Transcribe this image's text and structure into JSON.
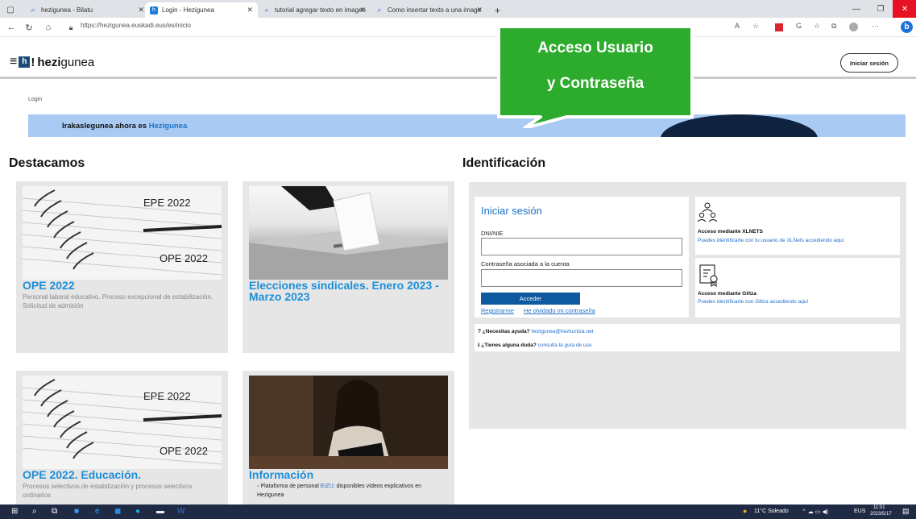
{
  "browser": {
    "tabs": [
      {
        "label": "hezigunea - Bilatu",
        "icon": "search-icon",
        "color": "#2b6fd6"
      },
      {
        "label": "Login - Hezigunea",
        "icon": "hezigunea-icon",
        "color": "#1c7ed6"
      },
      {
        "label": "tutorial agregar texto en imagen",
        "icon": "search-icon",
        "color": "#2b6fd6"
      },
      {
        "label": "Como insertar texto a una image",
        "icon": "search-icon",
        "color": "#2b6fd6"
      }
    ],
    "new_tab": "+",
    "url": "https://hezigunea.euskadi.eus/es/inicio"
  },
  "site": {
    "logo_prefix": "hezi",
    "logo_suffix": "gunea",
    "login_button": "Iniciar sesión",
    "breadcrumb": "Login",
    "banner_text": "Irakaslegunea ahora es ",
    "banner_link": "Hezigunea"
  },
  "callout": {
    "line1": "Acceso Usuario",
    "line2": "y Contraseña",
    "color": "#2cab2c"
  },
  "destacamos": {
    "title": "Destacamos",
    "cards": [
      {
        "title": "OPE 2022",
        "desc": "Personal laboral educativo. Proceso excepcional de estabilización. Solicitud de admisión",
        "img_top": "EPE 2022",
        "img_bottom": "OPE 2022"
      },
      {
        "title": "Elecciones sindicales. Enero 2023 - Marzo 2023",
        "desc": ""
      },
      {
        "title": "OPE 2022. Educación.",
        "desc": "Procesos selectivos de estabilización y procesos selectivos ordinarios",
        "img_top": "EPE 2022",
        "img_bottom": "OPE 2022"
      },
      {
        "title": "Información",
        "bullet_pre": "Plataforma de personal ",
        "bullet_link": "EIZU",
        "bullet_post": ": disponibles vídeos explicativos en Hezigunea"
      }
    ]
  },
  "identificacion": {
    "title": "Identificación",
    "form_title": "Iniciar sesión",
    "dni_label": "DNI/NIE",
    "password_label": "Contraseña asociada a la cuenta",
    "submit": "Acceder",
    "register": "Registrarme",
    "forgot": "He olvidado mi contraseña",
    "xlnets_title": "Acceso mediante XLNETS",
    "xlnets_desc": "Puedes identificarte con tu usuario de XLNets accediendo aquí",
    "giltza_title": "Acceso mediante Giltza",
    "giltza_desc": "Puedes identificarte con Giltza accediendo aquí",
    "help_label": "¿Necesitas ayuda?",
    "help_email": "hezigunea@hezkuntza.net",
    "doubt_label": "¿Tienes alguna duda?",
    "doubt_link": "consulta la guía de uso"
  },
  "taskbar": {
    "weather": "11°C  Soleado",
    "lang": "EUS",
    "time": "11:01",
    "date": "2023/5/17"
  }
}
